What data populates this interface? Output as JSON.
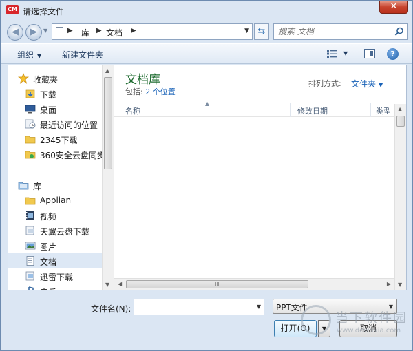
{
  "window": {
    "title": "请选择文件",
    "app_icon_text": "CM",
    "close_symbol": "✕"
  },
  "address": {
    "back_symbol": "◀",
    "forward_symbol": "▶",
    "crumbs": [
      "库",
      "文档"
    ],
    "search_placeholder": "搜索 文档"
  },
  "toolbar": {
    "organize_label": "组织",
    "new_folder_label": "新建文件夹",
    "help_symbol": "?"
  },
  "sidebar": {
    "items": [
      {
        "label": "收藏夹",
        "icon": "star-icon"
      },
      {
        "label": "下载",
        "icon": "download-folder-icon"
      },
      {
        "label": "桌面",
        "icon": "desktop-icon"
      },
      {
        "label": "最近访问的位置",
        "icon": "recent-places-icon"
      },
      {
        "label": "2345下载",
        "icon": "folder-icon"
      },
      {
        "label": "360安全云盘同步",
        "icon": "cloud-folder-icon"
      },
      {
        "label": "库",
        "icon": "library-icon"
      },
      {
        "label": "Applian",
        "icon": "folder-icon"
      },
      {
        "label": "视频",
        "icon": "video-icon"
      },
      {
        "label": "天翼云盘下载",
        "icon": "cloud-download-icon"
      },
      {
        "label": "图片",
        "icon": "pictures-icon"
      },
      {
        "label": "文档",
        "icon": "documents-icon"
      },
      {
        "label": "迅雷下载",
        "icon": "thunder-download-icon"
      },
      {
        "label": "音乐",
        "icon": "music-icon"
      }
    ],
    "selected": "文档"
  },
  "content": {
    "library_title": "文档库",
    "includes_prefix": "包括:",
    "includes_link": "2 个位置",
    "arrange_label": "排列方式:",
    "arrange_value": "文件夹",
    "columns": [
      "名称",
      "修改日期",
      "类型"
    ],
    "hscroll_grip": "III"
  },
  "footer": {
    "filename_label": "文件名(N):",
    "filename_value": "",
    "filetype_value": "PPT文件",
    "open_label": "打开(O)",
    "cancel_label": "取消"
  },
  "watermark": {
    "text": "当下软件园",
    "url": "www.downxia.com"
  },
  "colors": {
    "library_title": "#1e6b2f",
    "link": "#1a63b8",
    "close_button": "#c8452f"
  }
}
